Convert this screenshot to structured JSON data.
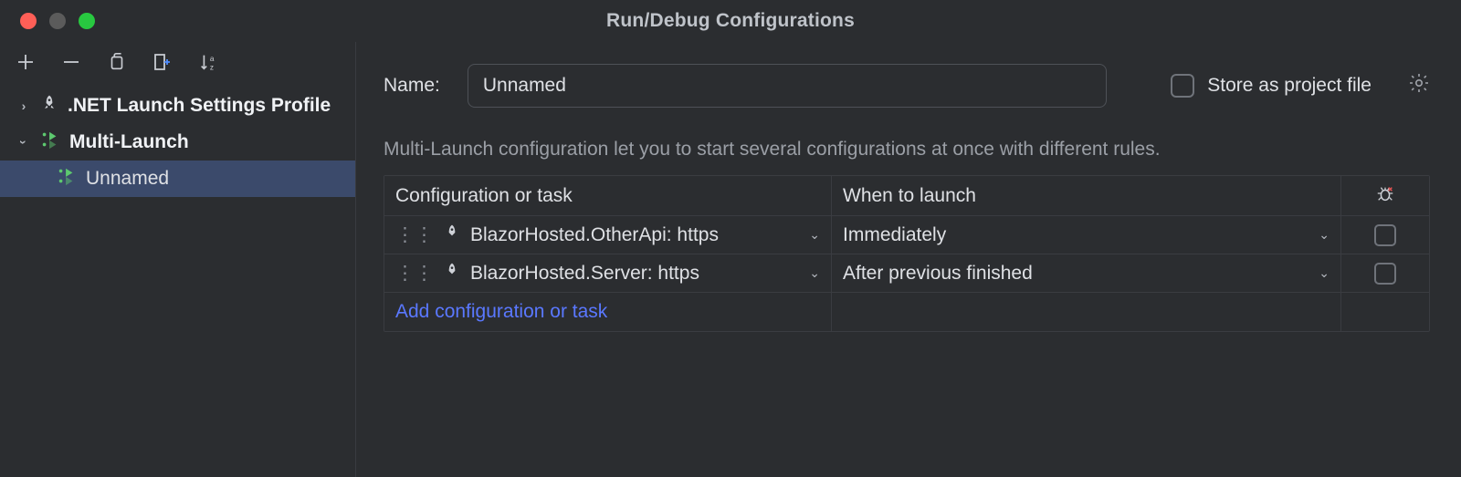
{
  "window": {
    "title": "Run/Debug Configurations"
  },
  "toolbar": {
    "add": "add",
    "remove": "remove",
    "copy": "copy",
    "save": "save",
    "sort": "sort"
  },
  "tree": {
    "nodes": [
      {
        "label": ".NET Launch Settings Profile",
        "expanded": false,
        "bold": true,
        "kind": "rocket"
      },
      {
        "label": "Multi-Launch",
        "expanded": true,
        "bold": true,
        "kind": "multi",
        "children": [
          {
            "label": "Unnamed",
            "selected": true,
            "kind": "multi"
          }
        ]
      }
    ]
  },
  "form": {
    "name_label": "Name:",
    "name_value": "Unnamed",
    "store_label": "Store as project file",
    "description": "Multi-Launch configuration let you to start several configurations at once with different rules."
  },
  "table": {
    "col_config": "Configuration or task",
    "col_when": "When to launch",
    "rows": [
      {
        "config": "BlazorHosted.OtherApi: https",
        "when": "Immediately",
        "debug": false
      },
      {
        "config": "BlazorHosted.Server: https",
        "when": "After previous finished",
        "debug": false
      }
    ],
    "add_link": "Add configuration or task"
  }
}
